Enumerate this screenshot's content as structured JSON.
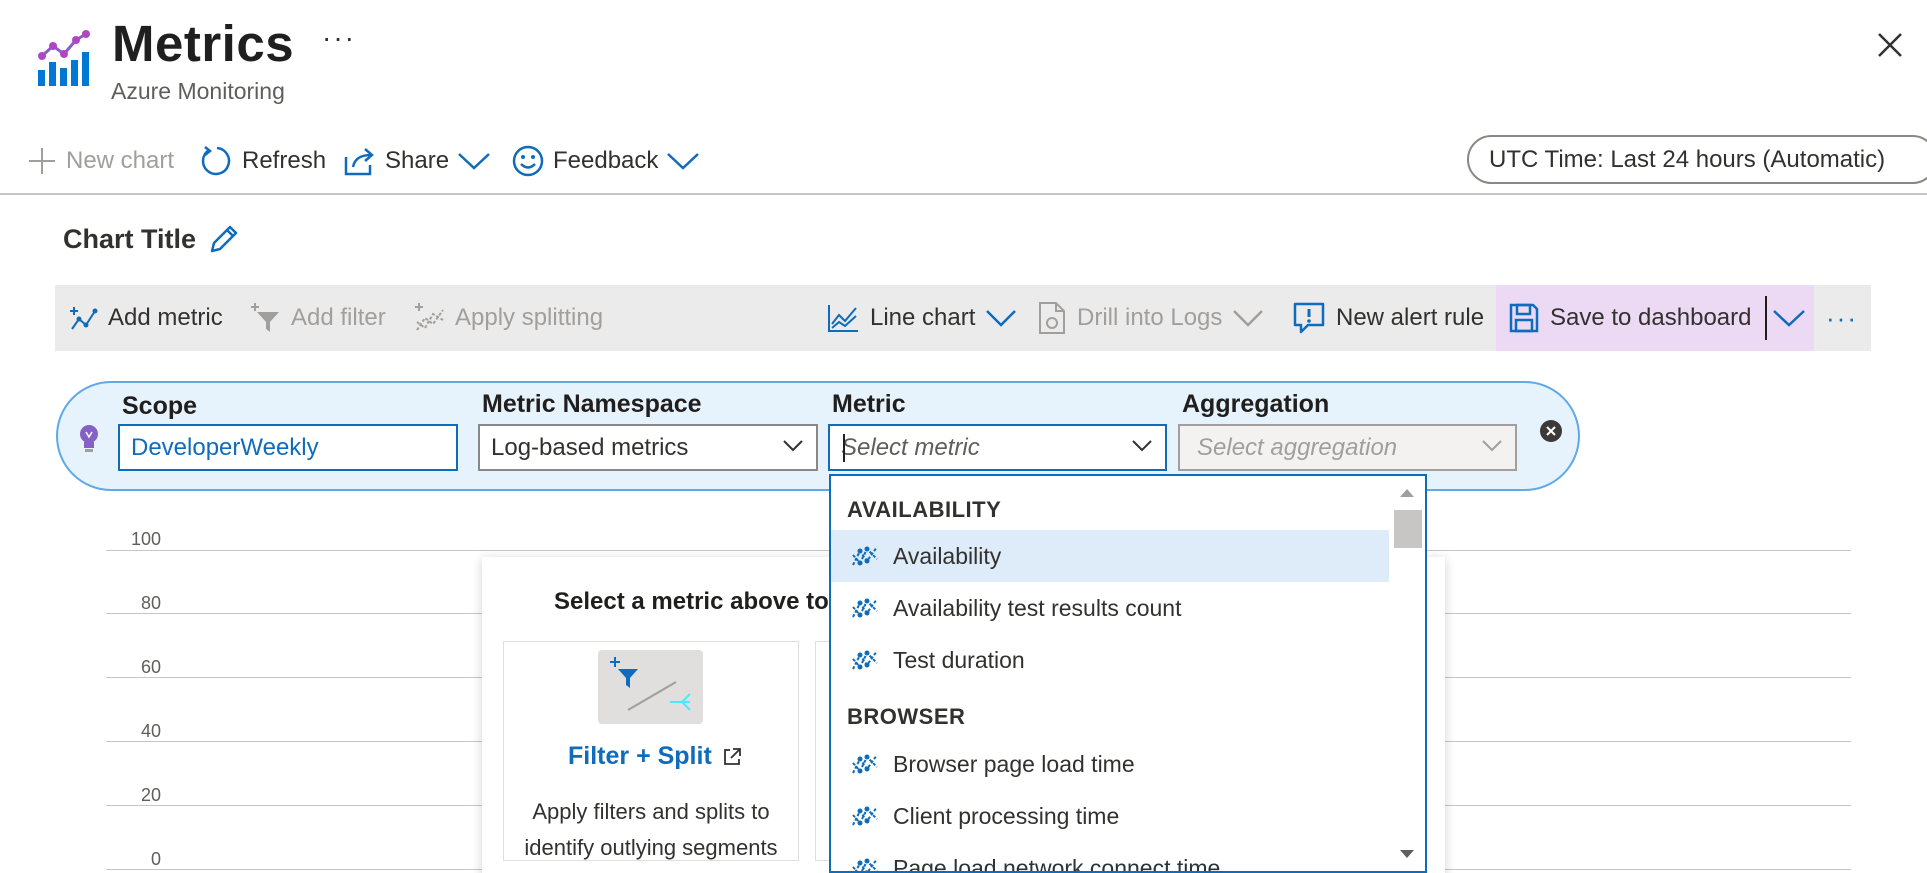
{
  "header": {
    "title": "Metrics",
    "subtitle": "Azure Monitoring",
    "more_label": "···"
  },
  "command_bar": {
    "new_chart": "New chart",
    "refresh": "Refresh",
    "share": "Share",
    "feedback": "Feedback",
    "time_range": "UTC Time: Last 24 hours (Automatic)"
  },
  "chart": {
    "title": "Chart Title",
    "y_ticks": [
      "100",
      "80",
      "60",
      "40",
      "20",
      "0"
    ]
  },
  "toolbar": {
    "add_metric": "Add metric",
    "add_filter": "Add filter",
    "apply_splitting": "Apply splitting",
    "line_chart": "Line chart",
    "drill_into_logs": "Drill into Logs",
    "new_alert_rule": "New alert rule",
    "save_to_dashboard": "Save to dashboard",
    "more": "···"
  },
  "metric_row": {
    "scope_label": "Scope",
    "scope_value": "DeveloperWeekly",
    "namespace_label": "Metric Namespace",
    "namespace_value": "Log-based metrics",
    "metric_label": "Metric",
    "metric_placeholder": "Select metric",
    "aggregation_label": "Aggregation",
    "aggregation_placeholder": "Select aggregation"
  },
  "empty_state": {
    "title": "Select a metric above to s",
    "tile_link": "Filter + Split",
    "tile_desc_line1": "Apply filters and splits to",
    "tile_desc_line2": "identify outlying segments"
  },
  "dropdown": {
    "groups": [
      {
        "label": "AVAILABILITY",
        "items": [
          "Availability",
          "Availability test results count",
          "Test duration"
        ]
      },
      {
        "label": "BROWSER",
        "items": [
          "Browser page load time",
          "Client processing time",
          "Page load network connect time"
        ]
      }
    ],
    "selected": "Availability"
  },
  "colors": {
    "accent": "#0f6cbd",
    "pill_background": "#e6f2fc",
    "selected_item": "#deecf9",
    "save_highlight": "#ecd9f4"
  }
}
